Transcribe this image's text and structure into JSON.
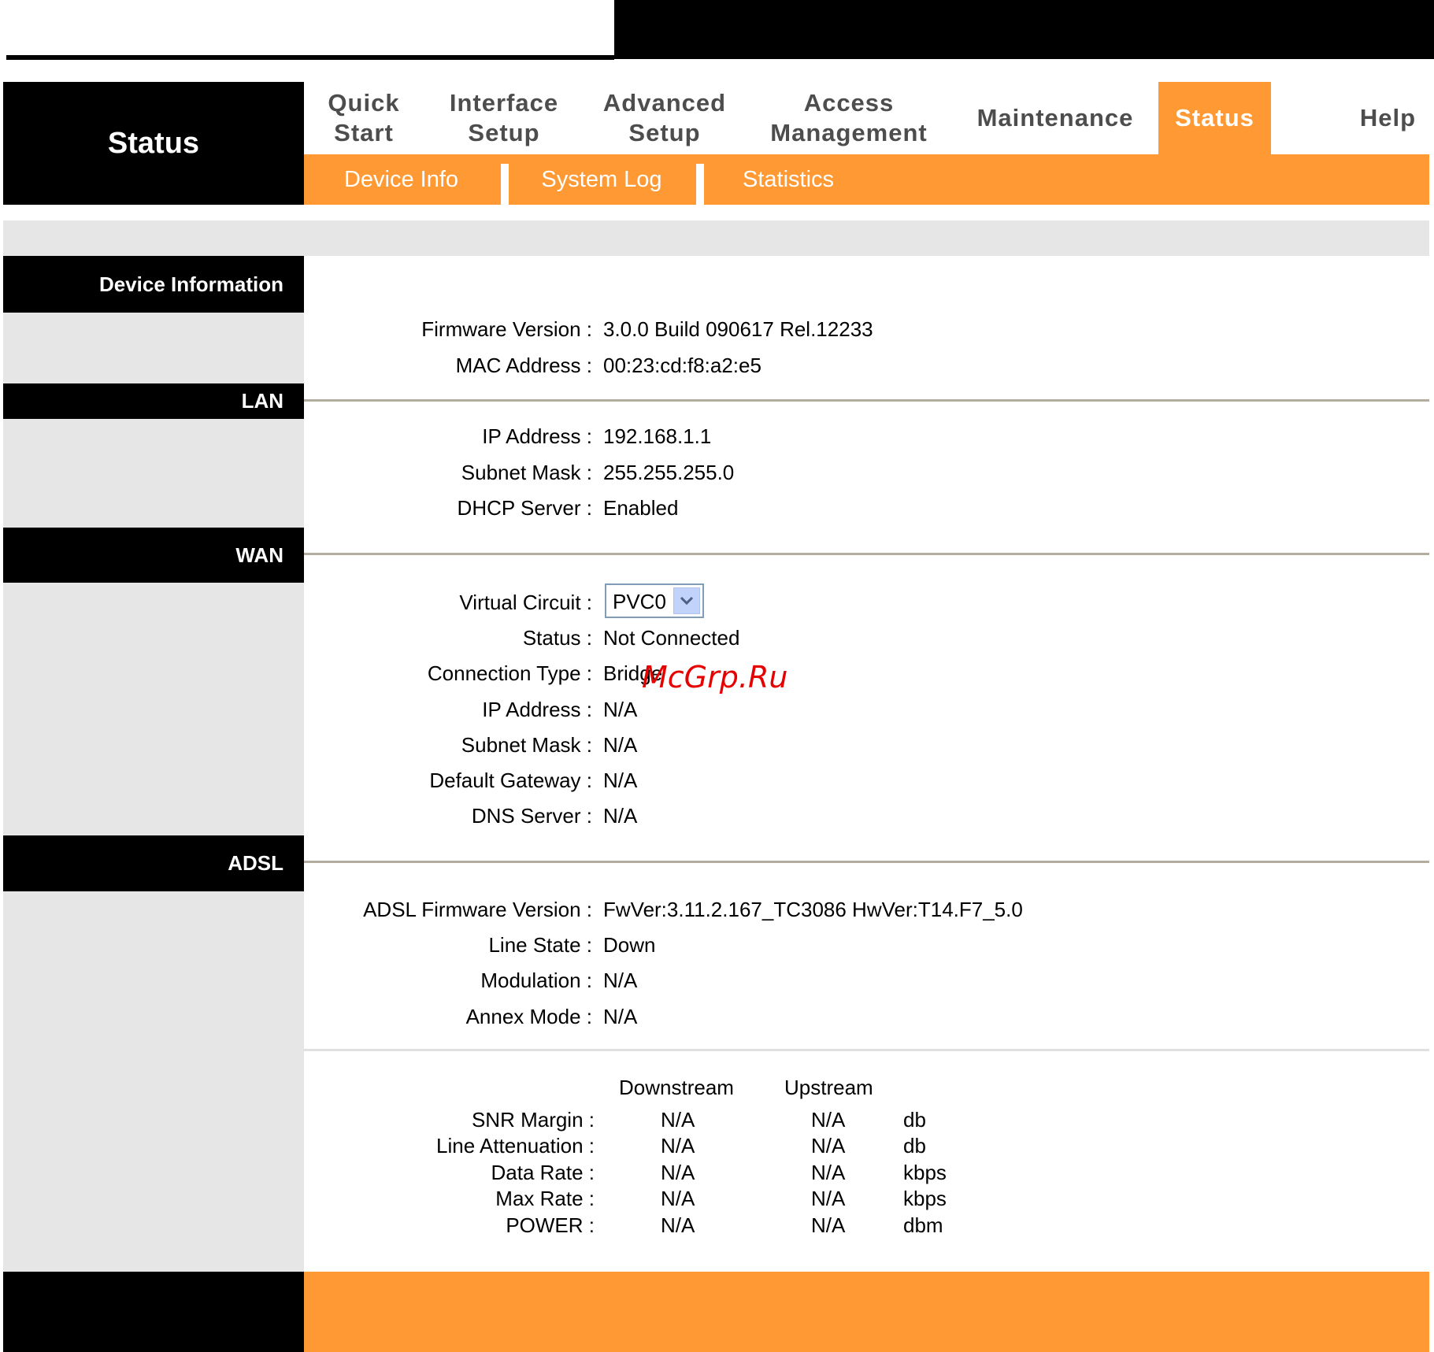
{
  "header": {
    "brand": "Status",
    "nav": [
      {
        "label": "Quick\nStart"
      },
      {
        "label": "Interface\nSetup"
      },
      {
        "label": "Advanced\nSetup"
      },
      {
        "label": "Access\nManagement"
      },
      {
        "label": "Maintenance"
      },
      {
        "label": "Status",
        "active": true
      },
      {
        "label": "Help"
      }
    ],
    "subtabs": [
      "Device Info",
      "System Log",
      "Statistics"
    ]
  },
  "sections": {
    "device_info": "Device Information",
    "lan": "LAN",
    "wan": "WAN",
    "adsl": "ADSL"
  },
  "device": {
    "firmware_label": "Firmware Version :",
    "firmware": "3.0.0 Build 090617 Rel.12233",
    "mac_label": "MAC Address :",
    "mac": "00:23:cd:f8:a2:e5"
  },
  "lan": {
    "ip_label": "IP Address :",
    "ip": "192.168.1.1",
    "mask_label": "Subnet Mask :",
    "mask": "255.255.255.0",
    "dhcp_label": "DHCP Server :",
    "dhcp": "Enabled"
  },
  "wan": {
    "vc_label": "Virtual Circuit :",
    "vc_selected": "PVC0",
    "status_label": "Status :",
    "status": "Not Connected",
    "conn_label": "Connection Type :",
    "conn": "Bridge",
    "ip_label": "IP Address :",
    "ip": "N/A",
    "mask_label": "Subnet Mask :",
    "mask": "N/A",
    "gw_label": "Default Gateway :",
    "gw": "N/A",
    "dns_label": "DNS Server :",
    "dns": "N/A"
  },
  "adsl": {
    "fw_label": "ADSL Firmware Version :",
    "fw": "FwVer:3.11.2.167_TC3086 HwVer:T14.F7_5.0",
    "line_label": "Line State :",
    "line": "Down",
    "mod_label": "Modulation :",
    "mod": "N/A",
    "annex_label": "Annex Mode :",
    "annex": "N/A",
    "table": {
      "downstream": "Downstream",
      "upstream": "Upstream",
      "rows": [
        {
          "label": "SNR Margin :",
          "down": "N/A",
          "up": "N/A",
          "unit": "db"
        },
        {
          "label": "Line Attenuation :",
          "down": "N/A",
          "up": "N/A",
          "unit": "db"
        },
        {
          "label": "Data Rate :",
          "down": "N/A",
          "up": "N/A",
          "unit": "kbps"
        },
        {
          "label": "Max Rate :",
          "down": "N/A",
          "up": "N/A",
          "unit": "kbps"
        },
        {
          "label": "POWER :",
          "down": "N/A",
          "up": "N/A",
          "unit": "dbm"
        }
      ]
    }
  },
  "watermark": "McGrp.Ru"
}
